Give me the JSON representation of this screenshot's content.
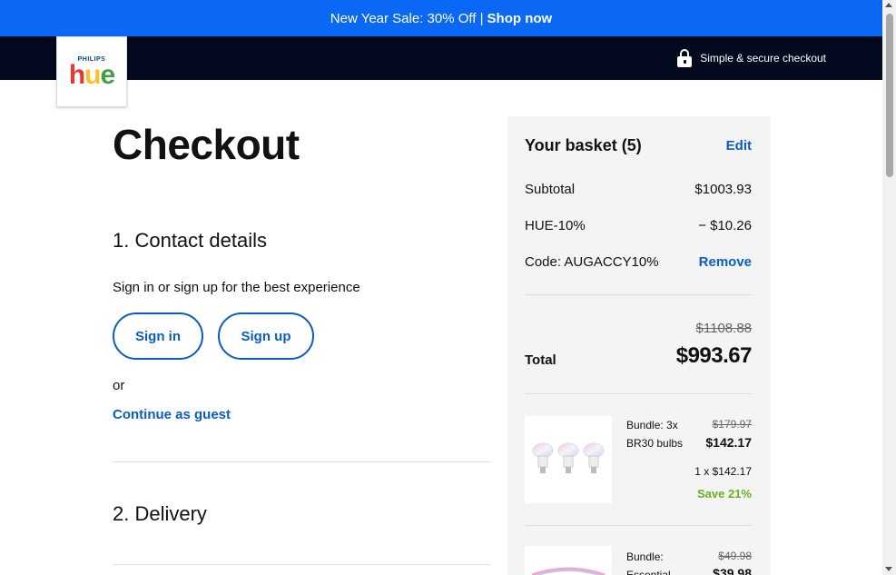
{
  "promo": {
    "text": "New Year Sale: 30% Off |",
    "link": "Shop now",
    "color": "#0a68f5"
  },
  "header": {
    "secure_label": "Simple & secure checkout",
    "lock_icon": "lock-icon",
    "background": "#030a1f"
  },
  "logo": {
    "brand": "PHILIPS",
    "wordmark": "hue"
  },
  "checkout": {
    "title": "Checkout",
    "contact": {
      "heading": "1. Contact details",
      "prompt": "Sign in or sign up for the best experience",
      "sign_in": "Sign in",
      "sign_up": "Sign up",
      "or": "or",
      "guest": "Continue as guest"
    },
    "delivery": {
      "heading": "2. Delivery"
    }
  },
  "basket": {
    "title": "Your basket (5)",
    "edit": "Edit",
    "subtotal_label": "Subtotal",
    "subtotal_value": "$1003.93",
    "discount_label": "HUE-10%",
    "discount_value": "− $10.26",
    "code_label": "Code: AUGACCY10%",
    "code_action": "Remove",
    "original_total": "$1108.88",
    "total_label": "Total",
    "total_value": "$993.67",
    "items": [
      {
        "name": "Bundle: 3x BR30 bulbs",
        "old_price": "$179.97",
        "price": "$142.17",
        "qty": "1 x $142.17",
        "save": "Save 21%"
      },
      {
        "name": "Bundle: Essential",
        "old_price": "$49.98",
        "price": "$39.98"
      }
    ],
    "accent_color": "#0a5dc2",
    "save_color": "#6ab023"
  }
}
